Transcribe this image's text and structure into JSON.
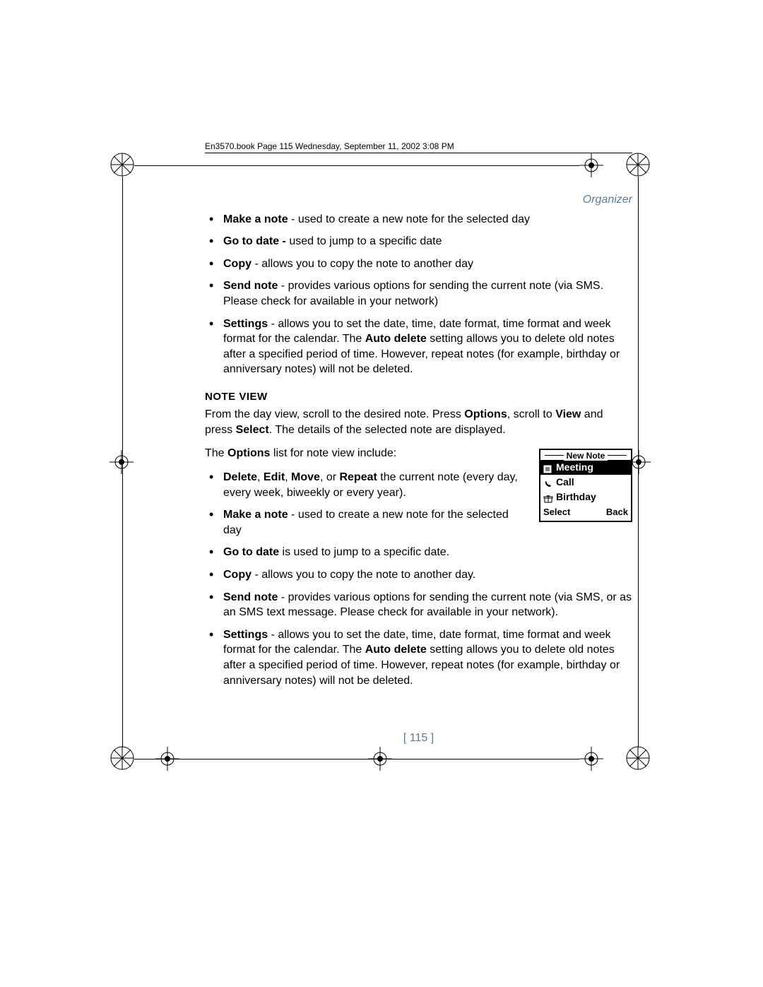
{
  "header": {
    "running": "En3570.book  Page 115  Wednesday, September 11, 2002  3:08 PM"
  },
  "section_label": "Organizer",
  "list1": {
    "i0": {
      "bold": "Make a note",
      "rest": " - used to create a new note for the selected day"
    },
    "i1": {
      "bold": "Go to date -",
      "rest": " used to jump to a specific date"
    },
    "i2": {
      "bold": "Copy",
      "rest": " - allows you to copy the note to another day"
    },
    "i3": {
      "bold": "Send note",
      "rest": " - provides various options for sending the current note (via SMS. Please check for available in your network)"
    },
    "i4": {
      "pre": "Settings",
      "mid1": " - allows you to set the date, time, date format, time format and week format for the calendar. The ",
      "bold2": "Auto delete",
      "mid2": " setting allows you to delete old notes after a specified period of time. However, repeat notes (for example, birthday or anniversary notes) will not be deleted."
    }
  },
  "note_view": {
    "heading": "NOTE VIEW",
    "intro": {
      "p1a": "From the day view, scroll to the desired note. Press ",
      "p1b": "Options",
      "p1c": ", scroll to ",
      "p1d": "View",
      "p1e": " and press ",
      "p1f": "Select",
      "p1g": ". The details of the selected note are displayed."
    },
    "options_lead_a": "The ",
    "options_lead_b": "Options",
    "options_lead_c": " list for note view include:"
  },
  "list2": {
    "i0": {
      "b1": "Delete",
      "c1": ", ",
      "b2": "Edit",
      "c2": ", ",
      "b3": "Move",
      "c3": ", or ",
      "b4": "Repeat",
      "rest": " the current note (every day, every week, biweekly or every year)."
    },
    "i1": {
      "bold": "Make a note",
      "rest": " - used to create a new note for the selected day"
    },
    "i2": {
      "bold": "Go to date",
      "rest": " is used to jump to a specific date."
    },
    "i3": {
      "bold": "Copy",
      "rest": " - allows you to copy the note to another day."
    },
    "i4": {
      "bold": "Send note",
      "rest": " - provides various options for sending the current note (via SMS, or as an SMS text message. Please check for available in your network)."
    },
    "i5": {
      "pre": "Settings",
      "mid1": " - allows you to set the date, time, date format, time format and week format for the calendar. The ",
      "bold2": "Auto delete",
      "mid2": " setting allows you to delete old notes after a specified period of time. However, repeat notes (for example, birthday or anniversary notes) will not be deleted."
    }
  },
  "phone": {
    "title": "New Note",
    "row1": "Meeting",
    "row2": "Call",
    "row3": "Birthday",
    "soft_left": "Select",
    "soft_right": "Back"
  },
  "page_number": "[ 115 ]"
}
